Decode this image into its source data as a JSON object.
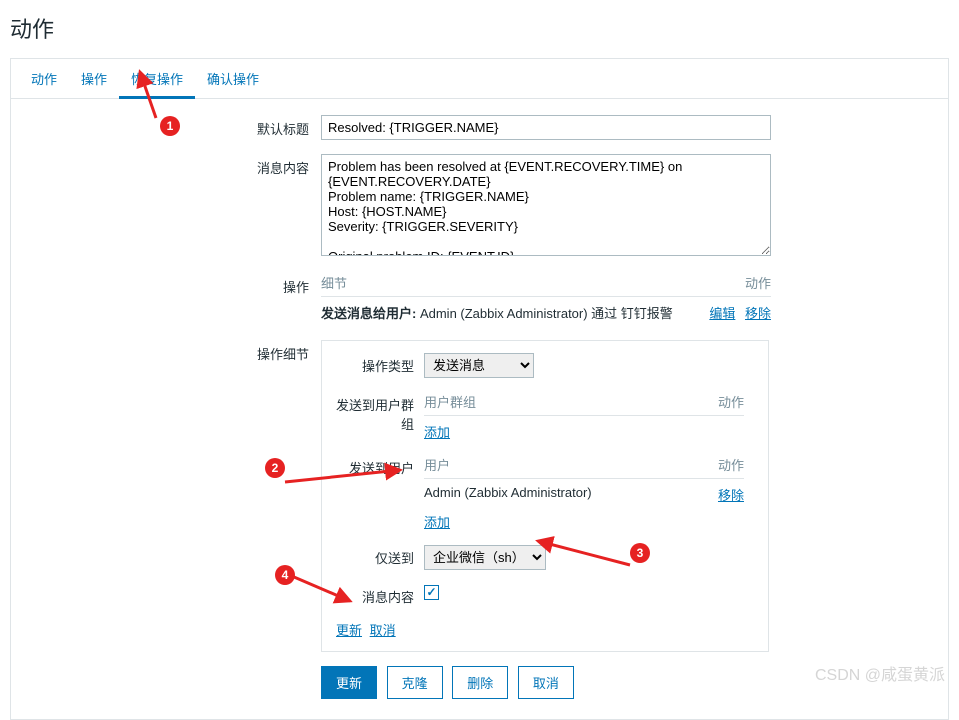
{
  "page_title": "动作",
  "tabs": [
    "动作",
    "操作",
    "恢复操作",
    "确认操作"
  ],
  "active_tab_index": 2,
  "default_title_label": "默认标题",
  "default_title_value": "Resolved: {TRIGGER.NAME}",
  "message_label": "消息内容",
  "message_value": "Problem has been resolved at {EVENT.RECOVERY.TIME} on {EVENT.RECOVERY.DATE}\nProblem name: {TRIGGER.NAME}\nHost: {HOST.NAME}\nSeverity: {TRIGGER.SEVERITY}\n\nOriginal problem ID: {EVENT.ID}",
  "ops_label": "操作",
  "ops_header_detail": "细节",
  "ops_header_action": "动作",
  "ops_row_bold": "发送消息给用户:",
  "ops_row_tail": " Admin (Zabbix Administrator) 通过 钉钉报警",
  "ops_action_edit": "编辑",
  "ops_action_remove": "移除",
  "detail_label": "操作细节",
  "op_type_label": "操作类型",
  "op_type_value": "发送消息",
  "send_group_label": "发送到用户群组",
  "send_user_label": "发送到用户",
  "col_usergroup": "用户群组",
  "col_user": "用户",
  "col_action": "动作",
  "add_label": "添加",
  "user_admin": "Admin (Zabbix Administrator)",
  "remove_label": "移除",
  "only_to_label": "仅送到",
  "only_to_value": "企业微信（sh）",
  "msg_content_label": "消息内容",
  "detail_update": "更新",
  "detail_cancel": "取消",
  "btn_update": "更新",
  "btn_clone": "克隆",
  "btn_delete": "删除",
  "btn_cancel": "取消",
  "watermark": "CSDN @咸蛋黄派",
  "badges": {
    "b1": "1",
    "b2": "2",
    "b3": "3",
    "b4": "4"
  }
}
